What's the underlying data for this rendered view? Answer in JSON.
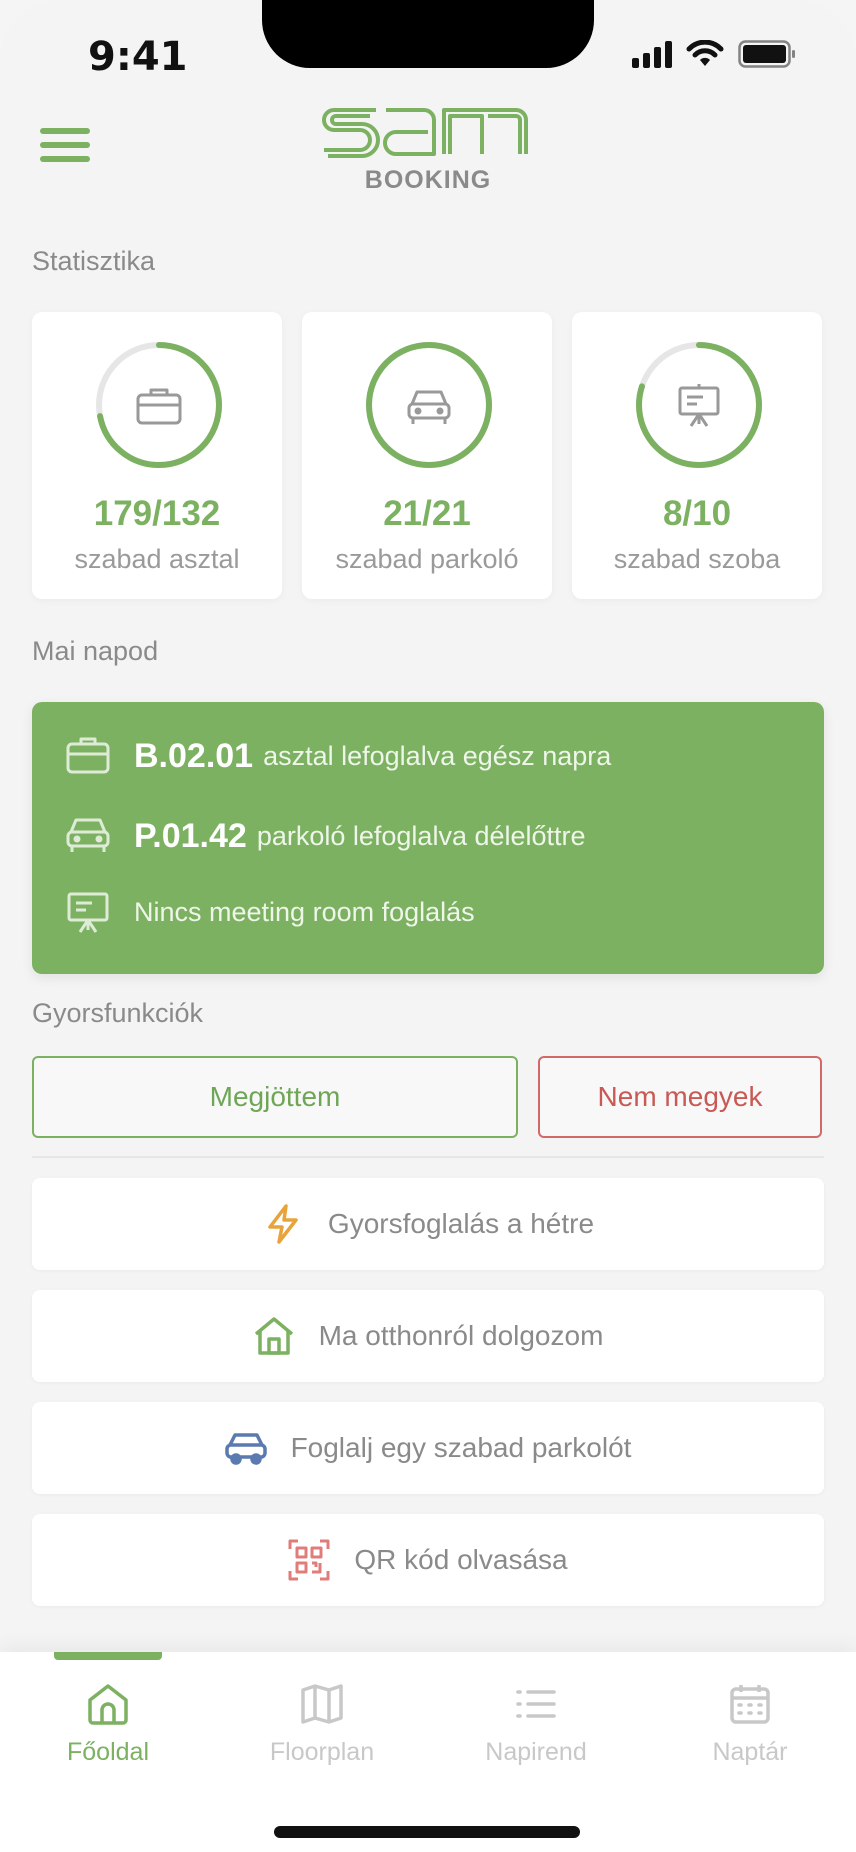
{
  "status_bar": {
    "time": "9:41"
  },
  "header": {
    "logo_text": "sam",
    "logo_sub": "BOOKING"
  },
  "colors": {
    "accent": "#7cb161",
    "danger": "#c85955",
    "warning": "#e8a33a",
    "blue": "#5a7ab0",
    "red_icon": "#e07c7a"
  },
  "stats": {
    "title": "Statisztika",
    "items": [
      {
        "icon": "briefcase-icon",
        "value": "179/132",
        "label": "szabad asztal",
        "progress": 0.72
      },
      {
        "icon": "car-icon",
        "value": "21/21",
        "label": "szabad parkoló",
        "progress": 1.0
      },
      {
        "icon": "presentation-icon",
        "value": "8/10",
        "label": "szabad szoba",
        "progress": 0.8
      }
    ]
  },
  "today": {
    "title": "Mai napod",
    "rows": [
      {
        "icon": "briefcase-icon",
        "code": "B.02.01",
        "text": "asztal lefoglalva egész napra"
      },
      {
        "icon": "car-icon",
        "code": "P.01.42",
        "text": "parkoló lefoglalva délelőttre"
      },
      {
        "icon": "presentation-icon",
        "code": "",
        "text": "Nincs meeting room foglalás"
      }
    ]
  },
  "quick": {
    "title": "Gyorsfunkciók",
    "arrived_label": "Megjöttem",
    "not_going_label": "Nem megyek",
    "actions": [
      {
        "icon": "lightning-icon",
        "label": "Gyorsfoglalás a hétre"
      },
      {
        "icon": "house-icon",
        "label": "Ma otthonról dolgozom"
      },
      {
        "icon": "car-icon",
        "label": "Foglalj egy szabad parkolót"
      },
      {
        "icon": "qr-code-icon",
        "label": "QR kód olvasása"
      }
    ]
  },
  "tabs": [
    {
      "icon": "home-icon",
      "label": "Főoldal",
      "active": true
    },
    {
      "icon": "map-icon",
      "label": "Floorplan",
      "active": false
    },
    {
      "icon": "list-icon",
      "label": "Napirend",
      "active": false
    },
    {
      "icon": "calendar-icon",
      "label": "Naptár",
      "active": false
    }
  ]
}
